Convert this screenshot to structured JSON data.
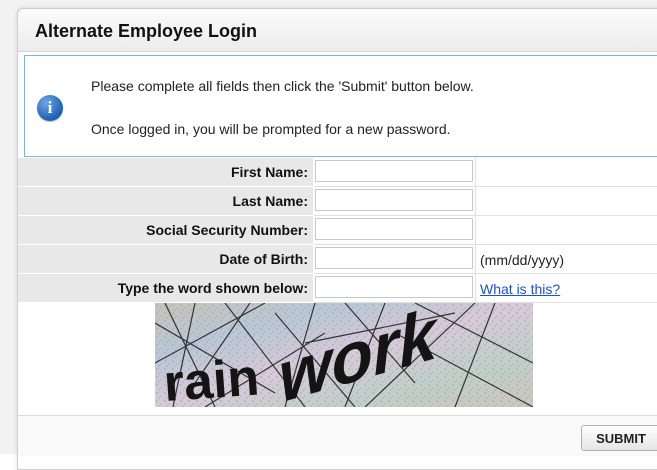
{
  "panel": {
    "title": "Alternate Employee Login"
  },
  "info": {
    "icon": "info-icon",
    "glyph": "i",
    "line1": "Please complete all fields then click the 'Submit' button below.",
    "line2": "Once logged in, you will be prompted for a new password."
  },
  "form": {
    "rows": [
      {
        "label": "First Name:",
        "value": ""
      },
      {
        "label": "Last Name:",
        "value": ""
      },
      {
        "label": "Social Security Number:",
        "value": ""
      },
      {
        "label": "Date of Birth:",
        "value": "",
        "hint": "(mm/dd/yyyy)"
      },
      {
        "label": "Type the word shown below:",
        "value": "",
        "link": "What is this?"
      }
    ]
  },
  "captcha": {
    "word": "rainwork"
  },
  "footer": {
    "submit_label": "SUBMIT"
  },
  "colors": {
    "info_border": "#7fb5d8",
    "link": "#1a4fd6",
    "label_bg": "#e8e8e8",
    "icon_blue": "#1c5fb5"
  }
}
